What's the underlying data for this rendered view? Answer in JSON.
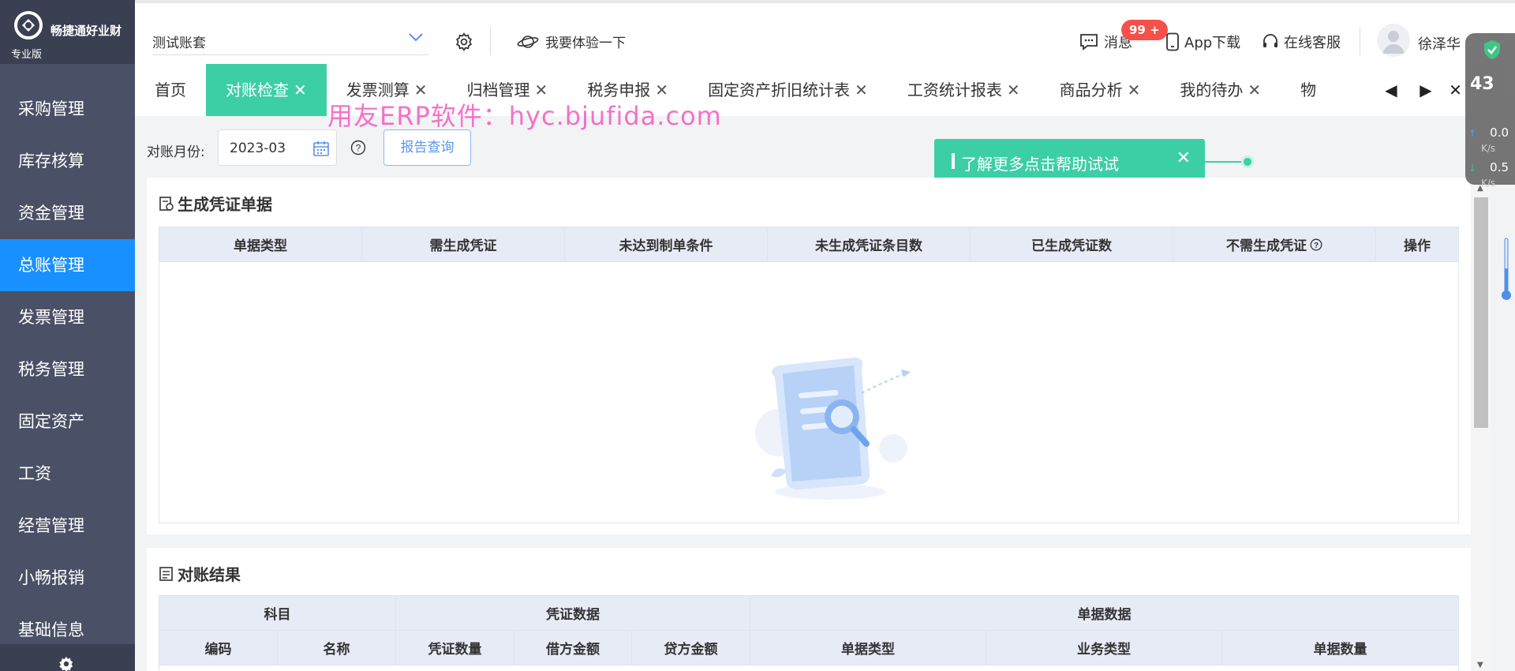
{
  "brand": {
    "name": "畅捷通好业财",
    "edition": "专业版"
  },
  "sidebar": {
    "items": [
      {
        "label": "采购管理"
      },
      {
        "label": "库存核算"
      },
      {
        "label": "资金管理"
      },
      {
        "label": "总账管理"
      },
      {
        "label": "发票管理"
      },
      {
        "label": "税务管理"
      },
      {
        "label": "固定资产"
      },
      {
        "label": "工资"
      },
      {
        "label": "经营管理"
      },
      {
        "label": "小畅报销"
      },
      {
        "label": "基础信息"
      }
    ],
    "active_index": 3
  },
  "header": {
    "account": "测试账套",
    "try_label": "我要体验一下",
    "messages_label": "消息",
    "messages_badge": "99 +",
    "app_download": "App下载",
    "online_service": "在线客服",
    "username": "徐泽华"
  },
  "tabs": [
    {
      "label": "首页",
      "closable": false
    },
    {
      "label": "对账检查",
      "closable": true,
      "active": true
    },
    {
      "label": "发票测算",
      "closable": true
    },
    {
      "label": "归档管理",
      "closable": true
    },
    {
      "label": "税务申报",
      "closable": true
    },
    {
      "label": "固定资产折旧统计表",
      "closable": true
    },
    {
      "label": "工资统计报表",
      "closable": true
    },
    {
      "label": "商品分析",
      "closable": true
    },
    {
      "label": "我的待办",
      "closable": true
    },
    {
      "label": "物",
      "closable": false
    }
  ],
  "watermark": "用友ERP软件：hyc.bjufida.com",
  "filter": {
    "label": "对账月份:",
    "month": "2023-03",
    "query_button": "报告查询"
  },
  "tip": {
    "text": "了解更多点击帮助试试"
  },
  "voucher_section": {
    "title": "生成凭证单据",
    "columns": [
      "单据类型",
      "需生成凭证",
      "未达到制单条件",
      "未生成凭证条目数",
      "已生成凭证数",
      "不需生成凭证",
      "操作"
    ]
  },
  "result_section": {
    "title": "对账结果",
    "group_headers": [
      "科目",
      "凭证数据",
      "单据数据"
    ],
    "columns": [
      "编码",
      "名称",
      "凭证数量",
      "借方金额",
      "贷方金额",
      "单据类型",
      "业务类型",
      "单据数量"
    ]
  },
  "net_widget": {
    "value": "43",
    "up": "0.0",
    "down": "0.5",
    "unit": "K/s"
  },
  "colors": {
    "sidebar": "#4a5065",
    "active_nav": "#1890ff",
    "active_tab": "#3ccfa6",
    "badge": "#f5504a"
  }
}
